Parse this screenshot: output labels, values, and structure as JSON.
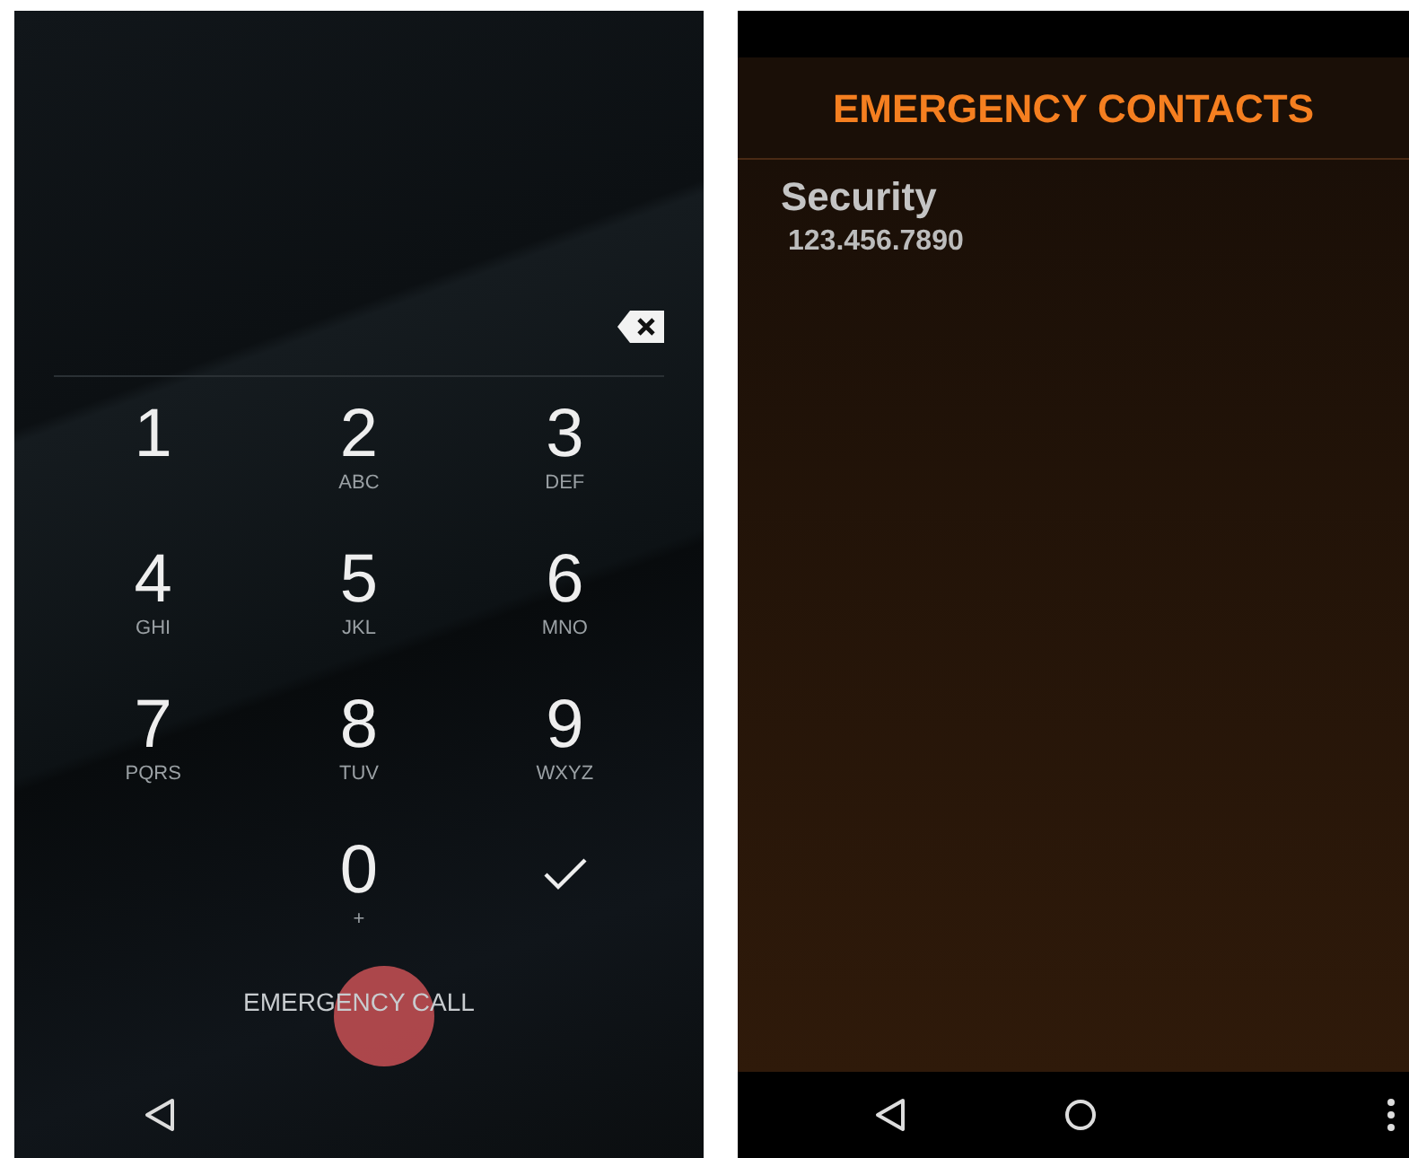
{
  "lock_screen": {
    "keys": [
      {
        "digit": "1"
      },
      {
        "digit": "2",
        "letters": "ABC"
      },
      {
        "digit": "3",
        "letters": "DEF"
      },
      {
        "digit": "4",
        "letters": "GHI"
      },
      {
        "digit": "5",
        "letters": "JKL"
      },
      {
        "digit": "6",
        "letters": "MNO"
      },
      {
        "digit": "7",
        "letters": "PQRS"
      },
      {
        "digit": "8",
        "letters": "TUV"
      },
      {
        "digit": "9",
        "letters": "WXYZ"
      },
      {
        "kind": "blank"
      },
      {
        "kind": "digit",
        "digit": "0",
        "letters": "+"
      },
      {
        "kind": "confirm"
      }
    ],
    "emergency_call": {
      "label": "EMERGENCY CALL",
      "pressed": true
    }
  },
  "emergency_contacts": {
    "title": "EMERGENCY CONTACTS",
    "contacts": [
      {
        "name": "Security",
        "number": "123.456.7890"
      }
    ]
  }
}
